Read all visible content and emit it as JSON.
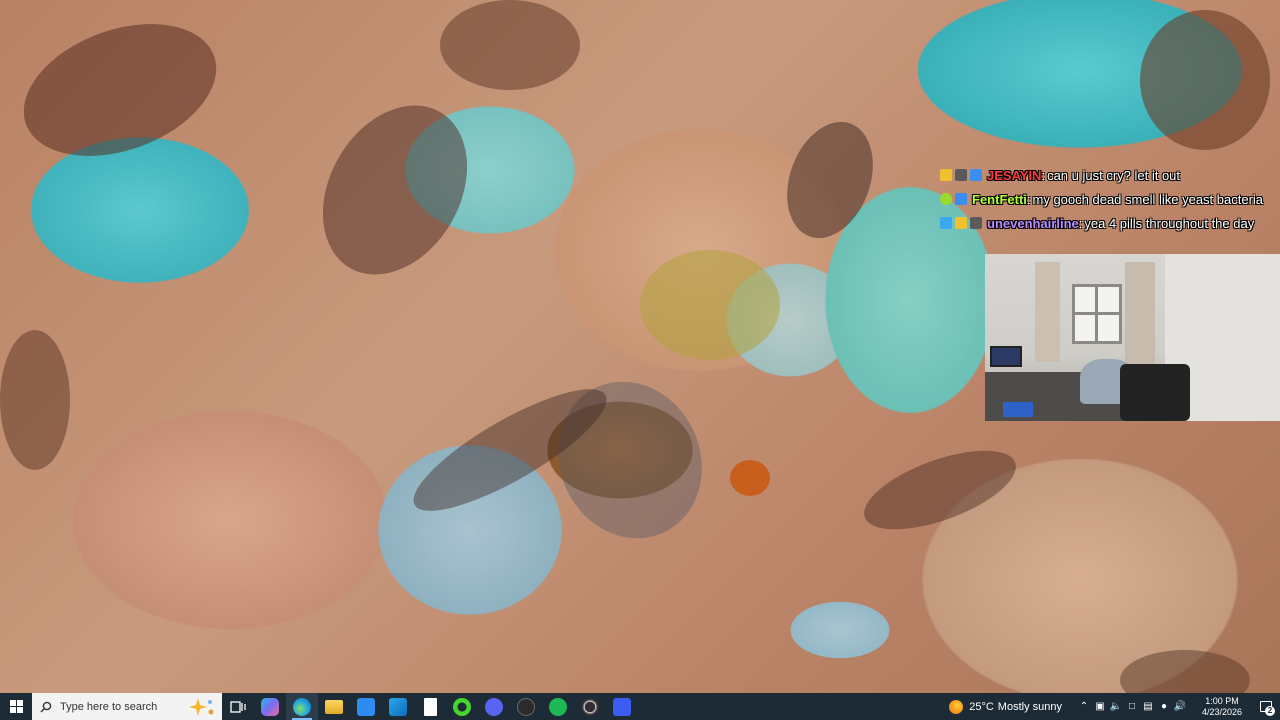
{
  "chat": {
    "messages": [
      {
        "username": "JESAYIN",
        "username_color": "#ff3b3b",
        "text": "can u just cry? let it out"
      },
      {
        "username": "FentFetti",
        "username_color": "#b6ff3b",
        "text": "my gooch dead smell like yeast bacteria"
      },
      {
        "username": "unevenhairline",
        "username_color": "#b78cff",
        "text": "yea 4 pills throughout the day"
      }
    ]
  },
  "taskbar": {
    "search_placeholder": "Type here to search",
    "apps": [
      {
        "name": "task-view-icon",
        "color": "#ffffff"
      },
      {
        "name": "copilot-icon",
        "color": "#7a6cf0"
      },
      {
        "name": "edge-icon",
        "color": "#1fa0e0"
      },
      {
        "name": "file-explorer-icon",
        "color": "#f4c542"
      },
      {
        "name": "microsoft-store-icon",
        "color": "#2d8cf0"
      },
      {
        "name": "outlook-icon",
        "color": "#0f6cbd"
      },
      {
        "name": "notepad-icon",
        "color": "#ffffff"
      },
      {
        "name": "razer-icon",
        "color": "#44d62c"
      },
      {
        "name": "discord-icon",
        "color": "#5865f2"
      },
      {
        "name": "media-player-icon",
        "color": "#2b2b2b"
      },
      {
        "name": "spotify-icon",
        "color": "#1db954"
      },
      {
        "name": "obs-icon",
        "color": "#302e31"
      },
      {
        "name": "app-blue-icon",
        "color": "#3a5cf0"
      }
    ],
    "weather": {
      "temp": "25°C",
      "condition": "Mostly sunny"
    },
    "clock": {
      "time": "1:00 PM",
      "date": "4/23/2026"
    },
    "notification_count": "2"
  }
}
